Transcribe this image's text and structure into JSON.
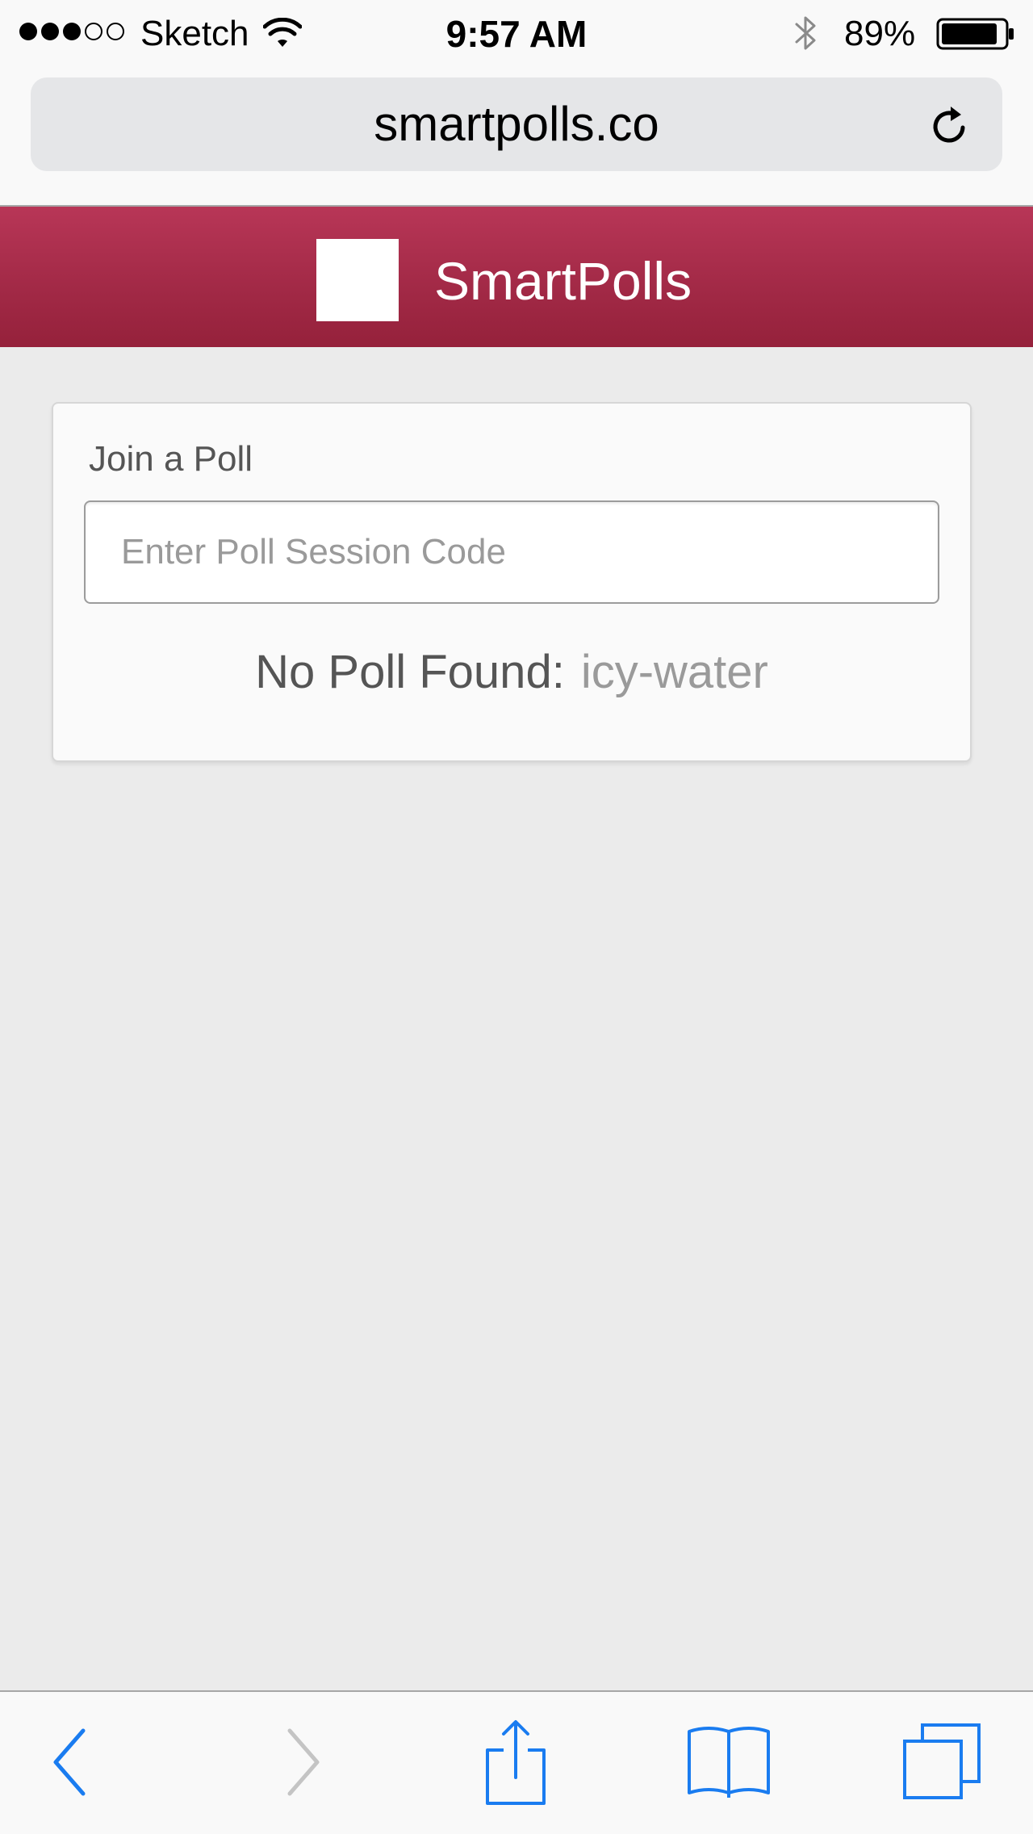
{
  "status_bar": {
    "carrier": "Sketch",
    "time": "9:57 AM",
    "battery_percent": "89%",
    "signal_strength": 3,
    "signal_max": 5,
    "battery_level": 0.89
  },
  "browser": {
    "url": "smartpolls.co"
  },
  "header": {
    "app_title": "SmartPolls"
  },
  "join_card": {
    "label": "Join a Poll",
    "input_placeholder": "Enter Poll Session Code",
    "input_value": "",
    "result_label": "No Poll Found:",
    "result_code": "icy-water"
  },
  "toolbar": {
    "icons": [
      "back-icon",
      "forward-icon",
      "share-icon",
      "bookmarks-icon",
      "tabs-icon"
    ]
  },
  "colors": {
    "header_top": "#b83657",
    "header_bottom": "#95213b",
    "ios_blue": "#1a7cf0",
    "disabled_gray": "#c4c4c4",
    "page_background": "#ebebeb"
  }
}
